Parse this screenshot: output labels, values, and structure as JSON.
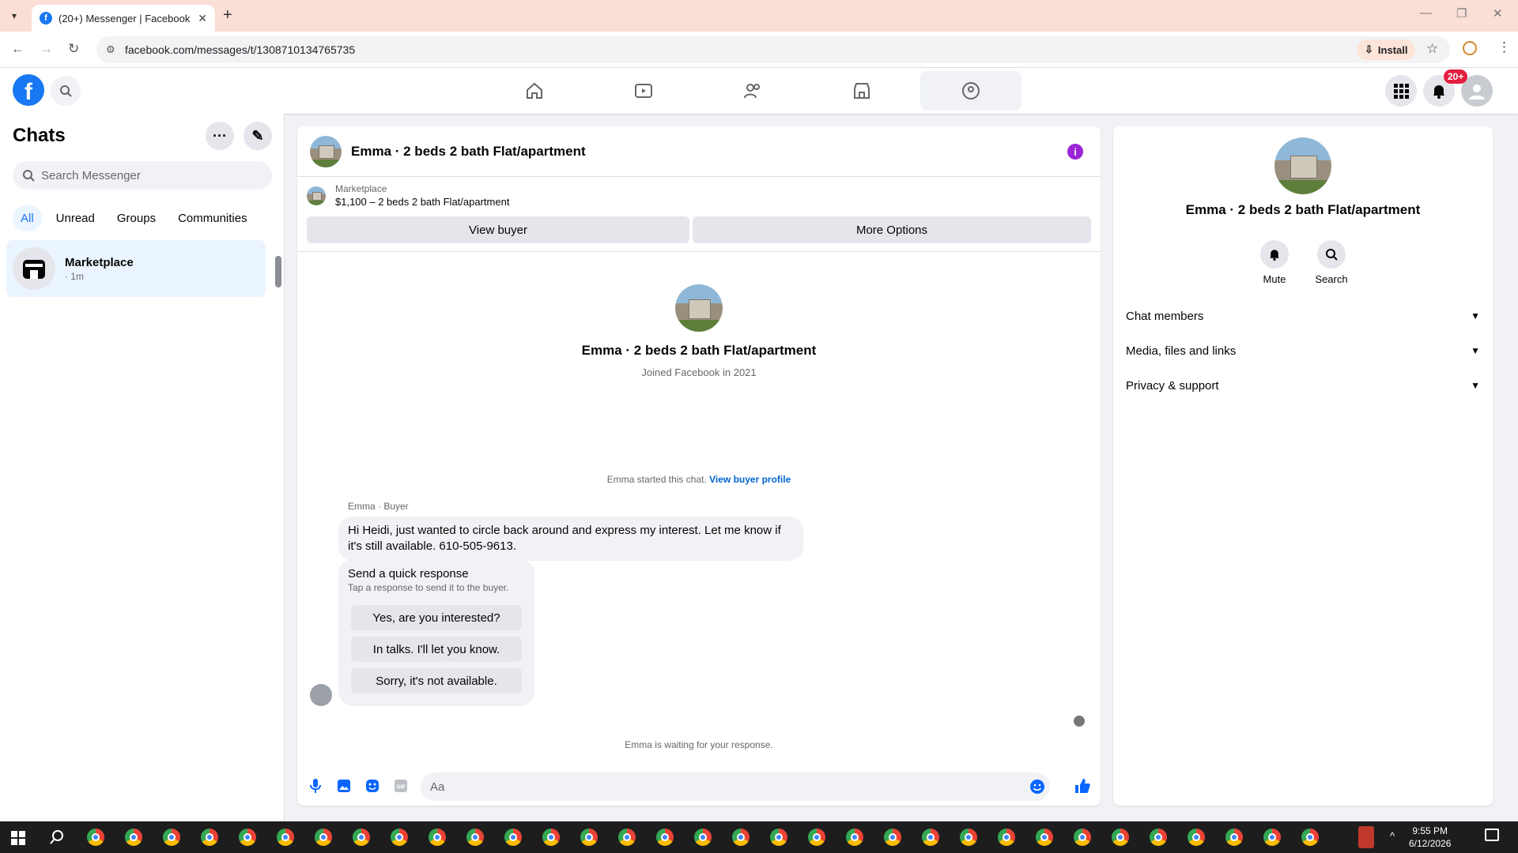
{
  "browser": {
    "tab_title": "(20+) Messenger | Facebook",
    "url": "facebook.com/messages/t/1308710134765735",
    "install_label": "Install"
  },
  "fb": {
    "notification_badge": "20+"
  },
  "sidebar": {
    "title": "Chats",
    "search_placeholder": "Search Messenger",
    "filters": [
      "All",
      "Unread",
      "Groups",
      "Communities"
    ],
    "active_filter": "All",
    "chat": {
      "name": "Marketplace",
      "time": "· 1m"
    }
  },
  "conversation": {
    "title": "Emma · 2 beds 2 bath Flat/apartment",
    "marketplace_label": "Marketplace",
    "listing": "$1,100 – 2 beds 2 bath Flat/apartment",
    "view_buyer": "View buyer",
    "more_options": "More Options",
    "profile_name": "Emma · 2 beds 2 bath Flat/apartment",
    "joined": "Joined Facebook in 2021",
    "started_text": "Emma started this chat.",
    "view_buyer_profile": "View buyer profile",
    "sender": "Emma · Buyer",
    "message": "Hi Heidi, just wanted to circle back around and express my interest. Let me know if it's still available. 610-505-9613.",
    "quick_title": "Send a quick response",
    "quick_sub": "Tap a response to send it to the buyer.",
    "quick_responses": [
      "Yes, are you interested?",
      "In talks. I'll let you know.",
      "Sorry, it's not available."
    ],
    "waiting": "Emma is waiting for your response.",
    "input_placeholder": "Aa"
  },
  "details": {
    "name": "Emma · 2 beds 2 bath Flat/apartment",
    "mute": "Mute",
    "search": "Search",
    "sections": [
      "Chat members",
      "Media, files and links",
      "Privacy & support"
    ]
  },
  "taskbar": {
    "time": "9:55 PM",
    "date": "6/12/2026"
  },
  "colors": {
    "accent": "#1877f2",
    "info": "#9b25d6"
  }
}
